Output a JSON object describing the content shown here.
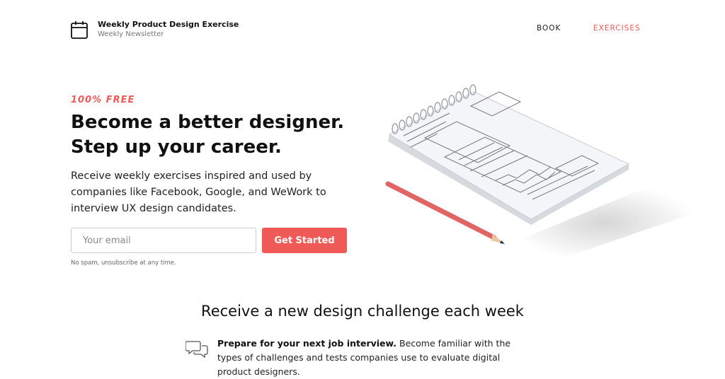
{
  "header": {
    "brand_title": "Weekly Product Design Exercise",
    "brand_subtitle": "Weekly Newsletter",
    "logo_icon": "calendar-icon",
    "nav": [
      {
        "label": "BOOK",
        "active": false
      },
      {
        "label": "EXERCISES",
        "active": true
      }
    ]
  },
  "hero": {
    "eyebrow": "100% FREE",
    "headline_line1": "Become a better designer.",
    "headline_line2": "Step up your career.",
    "lead": "Receive weekly exercises inspired and used by companies like Facebook, Google, and WeWork to interview UX design candidates.",
    "email_placeholder": "Your email",
    "email_value": "",
    "cta_label": "Get Started",
    "fine_print": "No spam, unsubscribe at any time."
  },
  "illustration": {
    "subject": "spiral notepad with wireframe sketches and red pencil",
    "icon": "notepad-illustration"
  },
  "features": {
    "heading": "Receive a new design challenge each week",
    "items": [
      {
        "icon": "chat-bubbles-icon",
        "bold": "Prepare for your next job interview.",
        "text": " Become familiar with the types of challenges and tests companies use to evaluate digital product designers."
      }
    ]
  },
  "colors": {
    "accent": "#ef5a57",
    "text": "#111111",
    "muted": "#777777",
    "background": "#ffffff"
  }
}
